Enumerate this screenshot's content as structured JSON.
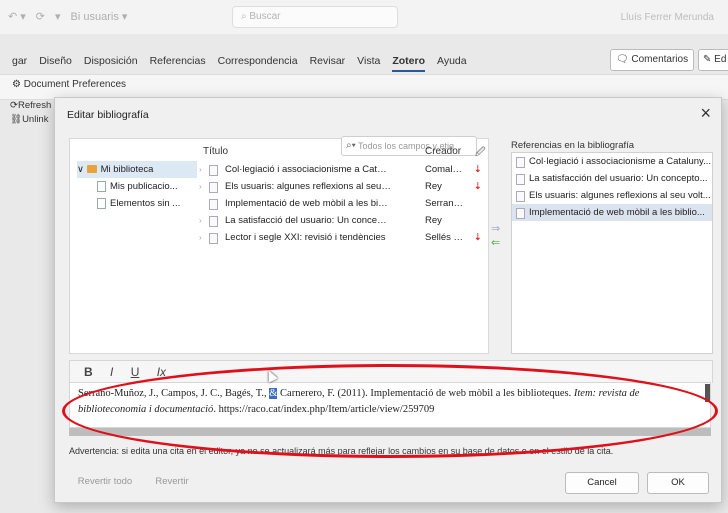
{
  "word": {
    "quick_access": [
      "↶ ▾",
      "⟳",
      "▾",
      "Bi usuaris ▾"
    ],
    "search_placeholder": "Buscar",
    "user": "Lluís Ferrer Merunda",
    "tabs": [
      "gar",
      "Diseño",
      "Disposición",
      "Referencias",
      "Correspondencia",
      "Revisar",
      "Vista",
      "Zotero",
      "Ayuda"
    ],
    "active_tab": "Zotero",
    "comments_button": "Comentarios",
    "edit_button": "Ed",
    "doc_preferences": "Document Preferences",
    "side_items": [
      "Refresh",
      "Unlink"
    ]
  },
  "dialog": {
    "title": "Editar bibliografía",
    "close": "×",
    "search_placeholder": "Todos los campos y etiq",
    "columns": {
      "title": "Título",
      "creator": "Creador",
      "attachment": "🖉"
    },
    "tree": [
      {
        "label": "Mi biblioteca",
        "type": "folder",
        "expanded": true
      },
      {
        "label": "Mis publicacio...",
        "type": "doc"
      },
      {
        "label": "Elementos sin ...",
        "type": "doc"
      }
    ],
    "items": [
      {
        "title": "Col·legiació i associacionisme a Cataluny...",
        "creator": "Comalat ...",
        "pdf": true
      },
      {
        "title": "Els usuaris: algunes reflexions al seu volta...",
        "creator": "Rey",
        "pdf": true
      },
      {
        "title": "Implementació de web mòbil a les bibliot...",
        "creator": "Serrano-...",
        "pdf": false
      },
      {
        "title": "La satisfacció del usuario: Un concepto ...",
        "creator": "Rey",
        "pdf": false
      },
      {
        "title": "Lector i segle XXI: revisió i tendències",
        "creator": "Sellés y S...",
        "pdf": true
      }
    ],
    "move_add": "⇒",
    "move_remove": "⇐",
    "refs_label": "Referencias en la bibliografía",
    "refs": [
      "Col·legiació i associacionisme a Cataluny...",
      "La satisfacción del usuario: Un concepto...",
      "Els usuaris: algunes reflexions al seu volt...",
      "Implementació de web mòbil a les biblio..."
    ],
    "editor_toolbar": [
      "B",
      "I",
      "U",
      "Ix"
    ],
    "citation": {
      "part1": "Serrano-Muñoz, J., Campos, J. C., Bagés, T., ",
      "highlight": "&",
      "part2": " Carnerero, F. (2011). Implementació de web mòbil a les biblioteques. ",
      "italic1": "Item: revista de",
      "italic2": "biblioteconomia i documentació",
      "part3": ". https://raco.cat/index.php/Item/article/view/259709"
    },
    "warning": "Advertencia: si edita una cita en el editor, ya no se actualizará más para reflejar los cambios en su base de datos o en el estilo de la cita.",
    "buttons": {
      "revert_all": "Revertir todo",
      "revert": "Revertir",
      "cancel": "Cancel",
      "ok": "OK"
    }
  },
  "colors": {
    "annotation_oval": "#e0101a",
    "accent": "#2b579a",
    "highlight": "#3b6fc4"
  }
}
